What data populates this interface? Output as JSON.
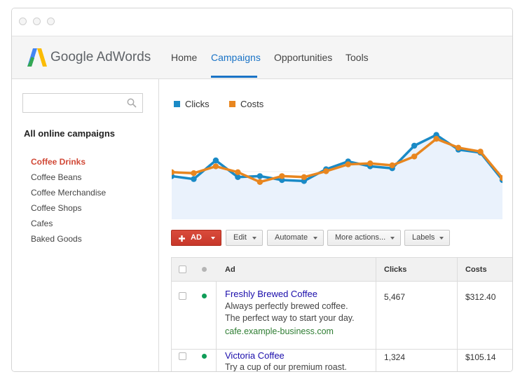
{
  "brand": {
    "name": "Google AdWords",
    "logo_icon": "adwords-logo-icon"
  },
  "nav": {
    "items": [
      {
        "label": "Home",
        "active": false
      },
      {
        "label": "Campaigns",
        "active": true
      },
      {
        "label": "Opportunities",
        "active": false
      },
      {
        "label": "Tools",
        "active": false
      }
    ]
  },
  "sidebar": {
    "search_placeholder": "",
    "title": "All online campaigns",
    "items": [
      {
        "label": "Coffee Drinks",
        "active": true
      },
      {
        "label": "Coffee Beans",
        "active": false
      },
      {
        "label": "Coffee Merchandise",
        "active": false
      },
      {
        "label": "Coffee Shops",
        "active": false
      },
      {
        "label": "Cafes",
        "active": false
      },
      {
        "label": "Baked Goods",
        "active": false
      }
    ]
  },
  "chart_data": {
    "type": "line",
    "title": "",
    "xlabel": "",
    "ylabel": "",
    "grid": false,
    "legend": "top-left",
    "x": [
      1,
      2,
      3,
      4,
      5,
      6,
      7,
      8,
      9,
      10,
      11,
      12,
      13,
      14,
      15,
      16
    ],
    "series": [
      {
        "name": "Clicks",
        "color": "#1a8ac6",
        "values": [
          44,
          41,
          60,
          43,
          44,
          40,
          39,
          51,
          59,
          54,
          52,
          75,
          86,
          71,
          68,
          40
        ]
      },
      {
        "name": "Costs",
        "color": "#e8861f",
        "values": [
          48,
          47,
          54,
          48,
          38,
          44,
          43,
          49,
          56,
          57,
          55,
          64,
          82,
          73,
          69,
          42
        ]
      }
    ],
    "area_series": "Clicks",
    "ylim": [
      0,
      100
    ]
  },
  "toolbar": {
    "ad_label": "AD",
    "edit_label": "Edit",
    "automate_label": "Automate",
    "more_label": "More actions...",
    "labels_label": "Labels"
  },
  "table": {
    "columns": [
      "Ad",
      "Clicks",
      "Costs"
    ],
    "rows": [
      {
        "title": "Freshly Brewed Coffee",
        "line1": "Always perfectly brewed coffee.",
        "line2": "The perfect way to start your day.",
        "url": "cafe.example-business.com",
        "clicks": "5,467",
        "costs": "$312.40",
        "status_color": "#0f9d58"
      },
      {
        "title": "Victoria Coffee",
        "line1": "Try a cup of our premium roast.",
        "clicks": "1,324",
        "costs": "$105.14",
        "status_color": "#0f9d58"
      }
    ]
  },
  "colors": {
    "accent": "#1a73c6",
    "active_campaign": "#d14836",
    "primary_button": "#c7372a"
  }
}
